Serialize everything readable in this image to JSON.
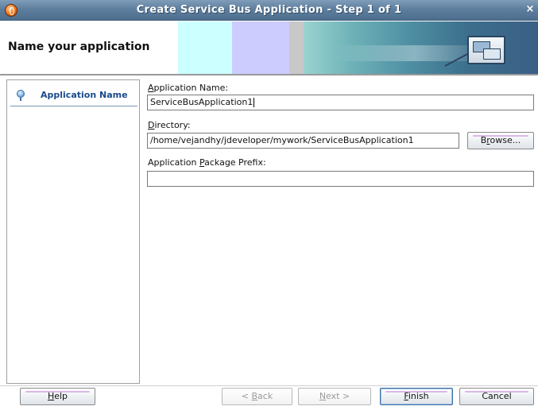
{
  "window": {
    "title": "Create Service Bus Application - Step 1 of 1",
    "close_glyph": "×",
    "app_icon": "oracle-jdeveloper-icon"
  },
  "banner": {
    "title": "Name your application",
    "icon": "wizard-windows-icon"
  },
  "nav": {
    "items": [
      {
        "label": "Application Name",
        "icon": "lightbulb-icon",
        "selected": true
      }
    ]
  },
  "form": {
    "app_name": {
      "mnemonic": "A",
      "label_rest": "pplication Name:",
      "value": "ServiceBusApplication1"
    },
    "directory": {
      "mnemonic": "D",
      "label_rest": "irectory:",
      "value": "/home/vejandhy/jdeveloper/mywork/ServiceBusApplication1"
    },
    "package_prefix": {
      "label_before": "Application ",
      "mnemonic": "P",
      "label_rest": "ackage Prefix:",
      "value": ""
    },
    "browse": {
      "before": "B",
      "mnemonic": "r",
      "after": "owse..."
    }
  },
  "buttons": {
    "help": {
      "mnemonic": "H",
      "rest": "elp"
    },
    "back": {
      "prefix": "< ",
      "mnemonic": "B",
      "rest": "ack"
    },
    "next": {
      "mnemonic": "N",
      "rest": "ext >"
    },
    "finish": {
      "mnemonic": "F",
      "rest": "inish"
    },
    "cancel": {
      "label": "Cancel"
    }
  }
}
